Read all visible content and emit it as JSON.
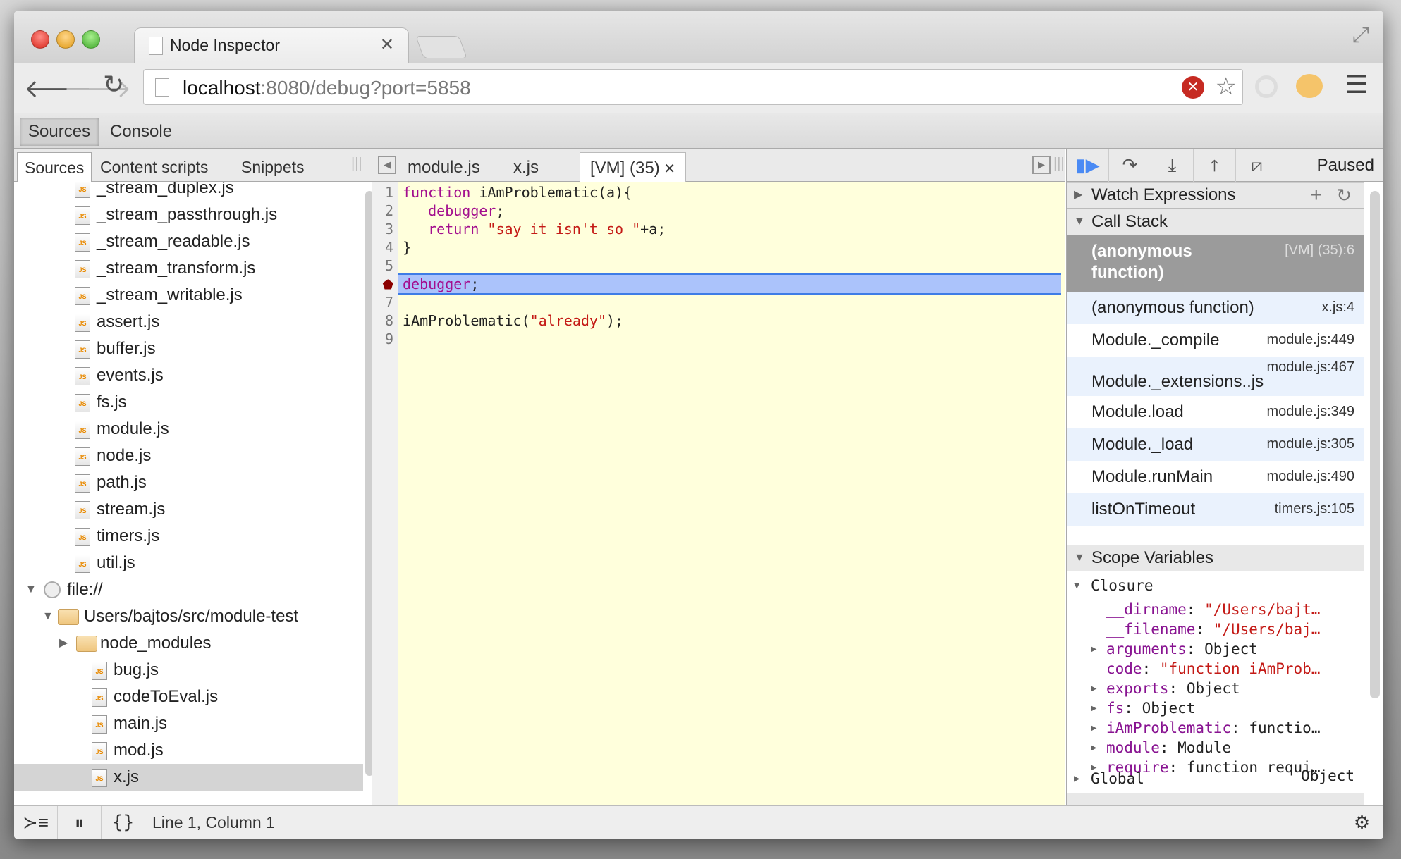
{
  "browser": {
    "tab_title": "Node Inspector",
    "url_host": "localhost",
    "url_rest": ":8080/debug?port=5858"
  },
  "devtools_tabs": [
    "Sources",
    "Console"
  ],
  "navigator": {
    "tabs": [
      "Sources",
      "Content scripts",
      "Snippets"
    ],
    "node_files": [
      "_stream_duplex.js",
      "_stream_passthrough.js",
      "_stream_readable.js",
      "_stream_transform.js",
      "_stream_writable.js",
      "assert.js",
      "buffer.js",
      "events.js",
      "fs.js",
      "module.js",
      "node.js",
      "path.js",
      "stream.js",
      "timers.js",
      "util.js"
    ],
    "file_root": "file://",
    "folder": "Users/bajtos/src/module-test",
    "subfolder": "node_modules",
    "project_files": [
      "bug.js",
      "codeToEval.js",
      "main.js",
      "mod.js",
      "x.js"
    ],
    "selected_file": "x.js"
  },
  "editor": {
    "tabs": [
      "module.js",
      "x.js",
      "[VM] (35)"
    ],
    "active_tab": "[VM] (35)",
    "execution_line": 6,
    "lines": [
      [
        {
          "t": "function",
          "c": "kw"
        },
        {
          "t": " iAmProblematic(a){"
        }
      ],
      [
        {
          "t": "   "
        },
        {
          "t": "debugger",
          "c": "kw"
        },
        {
          "t": ";"
        }
      ],
      [
        {
          "t": "   "
        },
        {
          "t": "return",
          "c": "kw"
        },
        {
          "t": " "
        },
        {
          "t": "\"say it isn't so \"",
          "c": "str"
        },
        {
          "t": "+a;"
        }
      ],
      [
        {
          "t": "}"
        }
      ],
      [],
      [
        {
          "t": "debugger",
          "c": "kw"
        },
        {
          "t": ";"
        }
      ],
      [],
      [
        {
          "t": "iAmProblematic("
        },
        {
          "t": "\"already\"",
          "c": "str"
        },
        {
          "t": ");"
        }
      ],
      []
    ]
  },
  "debugger": {
    "status": "Paused",
    "watch_label": "Watch Expressions",
    "callstack_label": "Call Stack",
    "callstack": [
      {
        "fn": "(anonymous function)",
        "loc": "[VM] (35):6"
      },
      {
        "fn": "(anonymous function)",
        "loc": "x.js:4"
      },
      {
        "fn": "Module._compile",
        "loc": "module.js:449"
      },
      {
        "fn": "Module._extensions..js",
        "loc": "module.js:467"
      },
      {
        "fn": "Module.load",
        "loc": "module.js:349"
      },
      {
        "fn": "Module._load",
        "loc": "module.js:305"
      },
      {
        "fn": "Module.runMain",
        "loc": "module.js:490"
      },
      {
        "fn": "listOnTimeout",
        "loc": "timers.js:105"
      }
    ],
    "scope_label": "Scope Variables",
    "closure_label": "Closure",
    "closure": [
      {
        "name": "__dirname",
        "value": "\"/Users/bajt…",
        "str": true,
        "expand": false
      },
      {
        "name": "__filename",
        "value": "\"/Users/baj…",
        "str": true,
        "expand": false
      },
      {
        "name": "arguments",
        "value": "Object",
        "expand": true
      },
      {
        "name": "code",
        "value": "\"function iAmProb…",
        "str": true,
        "expand": false
      },
      {
        "name": "exports",
        "value": "Object",
        "expand": true
      },
      {
        "name": "fs",
        "value": "Object",
        "expand": true
      },
      {
        "name": "iAmProblematic",
        "value": "functio…",
        "expand": true
      },
      {
        "name": "module",
        "value": "Module",
        "expand": true
      },
      {
        "name": "require",
        "value": "function requi…",
        "expand": true
      }
    ],
    "global_label": "Global",
    "global_value": "Object"
  },
  "status": {
    "position": "Line 1, Column 1"
  },
  "colors": {
    "keyword": "#a30e8e",
    "string": "#c41a16",
    "exec_line": "#abc3fb",
    "editor_bg": "#ffffdc",
    "resume": "#4a8af4"
  }
}
